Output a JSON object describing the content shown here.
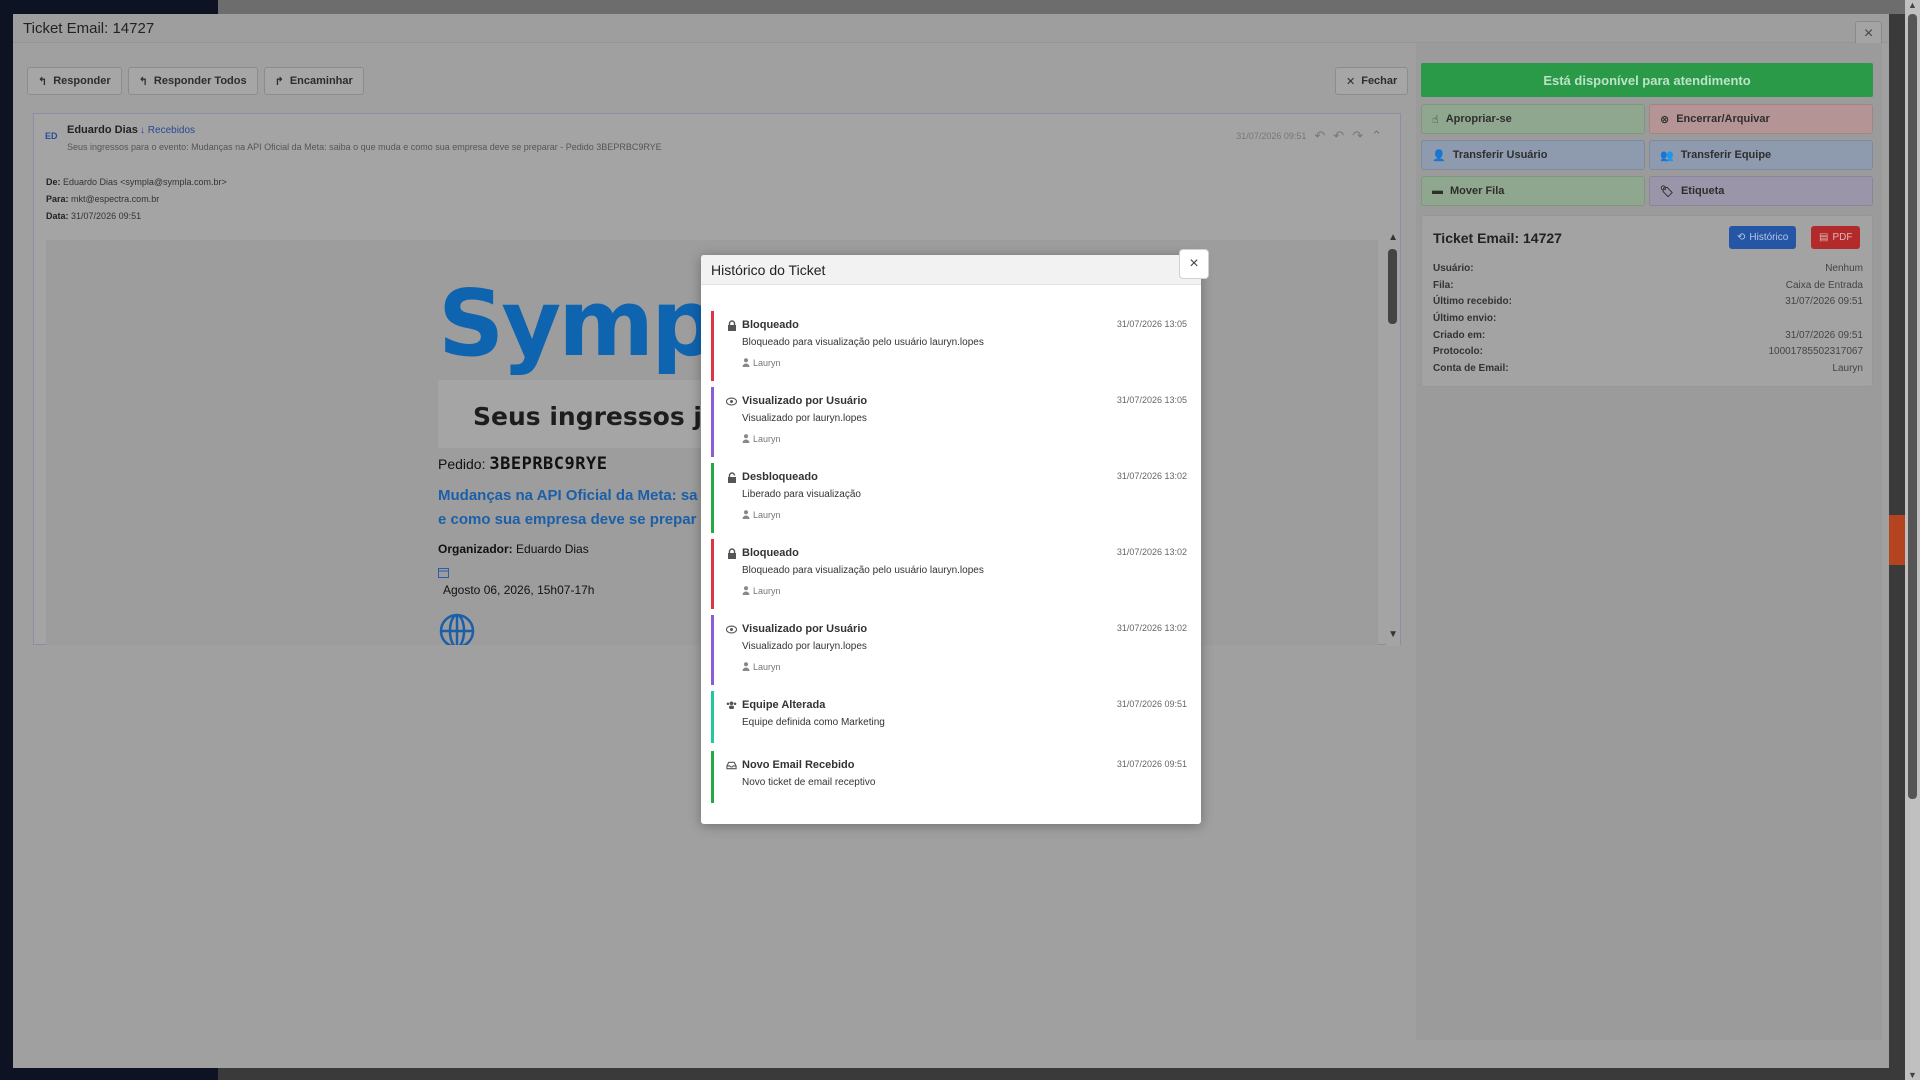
{
  "window": {
    "title": "Ticket Email: 14727",
    "close_label": "×"
  },
  "toolbar": {
    "reply_label": "Responder",
    "reply_all_label": "Responder Todos",
    "forward_label": "Encaminhar",
    "close_label": "Fechar"
  },
  "email": {
    "avatar_initials": "ED",
    "sender_name": "Eduardo Dias",
    "folder_label": "Recebidos",
    "subject": "Seus ingressos para o evento: Mudanças na API Oficial da Meta: saiba o que muda e como sua empresa deve se preparar - Pedido 3BEPRBC9RYE",
    "timestamp": "31/07/2026 09:51",
    "from_label": "De:",
    "from_value": "Eduardo Dias <sympla@sympla.com.br>",
    "to_label": "Para:",
    "to_value": "mkt@espectra.com.br",
    "date_label": "Data:",
    "date_value": "31/07/2026 09:51",
    "body": {
      "logo_text": "Sympl",
      "card_title": "Seus ingressos já",
      "order_label": "Pedido:",
      "order_code": "3BEPRBC9RYE",
      "event_line1": "Mudanças na API Oficial da Meta: sa",
      "event_line2": "e como sua empresa deve se prepar",
      "organizer_label": "Organizador:",
      "organizer_name": "Eduardo Dias",
      "event_date": "Agosto 06, 2026, 15h07-17h"
    }
  },
  "sidebar": {
    "status_label": "Está disponível para atendimento",
    "actions": {
      "claim": "Apropriar-se",
      "close_archive": "Encerrar/Arquivar",
      "transfer_user": "Transferir Usuário",
      "transfer_team": "Transferir Equipe",
      "move_queue": "Mover Fila",
      "tag": "Etiqueta"
    },
    "info": {
      "title": "Ticket Email: 14727",
      "history_button": "Histórico",
      "pdf_button": "PDF",
      "rows": [
        {
          "label": "Usuário:",
          "value": "Nenhum"
        },
        {
          "label": "Fila:",
          "value": "Caixa de Entrada"
        },
        {
          "label": "Último recebido:",
          "value": "31/07/2026 09:51"
        },
        {
          "label": "Último envio:",
          "value": ""
        },
        {
          "label": "Criado em:",
          "value": "31/07/2026 09:51"
        },
        {
          "label": "Protocolo:",
          "value": "10001785502317067"
        },
        {
          "label": "Conta de Email:",
          "value": "Lauryn"
        }
      ]
    }
  },
  "history": {
    "title": "Histórico do Ticket",
    "close_label": "×",
    "items": [
      {
        "icon": "lock-icon",
        "color": "#dc3545",
        "title": "Bloqueado",
        "time": "31/07/2026 13:05",
        "desc": "Bloqueado para visualização pelo usuário lauryn.lopes",
        "user": "Lauryn"
      },
      {
        "icon": "eye-icon",
        "color": "#8a5cd6",
        "title": "Visualizado por Usuário",
        "time": "31/07/2026 13:05",
        "desc": "Visualizado por lauryn.lopes",
        "user": "Lauryn"
      },
      {
        "icon": "unlock-icon",
        "color": "#28a745",
        "title": "Desbloqueado",
        "time": "31/07/2026 13:02",
        "desc": "Liberado para visualização",
        "user": "Lauryn"
      },
      {
        "icon": "lock-icon",
        "color": "#dc3545",
        "title": "Bloqueado",
        "time": "31/07/2026 13:02",
        "desc": "Bloqueado para visualização pelo usuário lauryn.lopes",
        "user": "Lauryn"
      },
      {
        "icon": "eye-icon",
        "color": "#8a5cd6",
        "title": "Visualizado por Usuário",
        "time": "31/07/2026 13:02",
        "desc": "Visualizado por lauryn.lopes",
        "user": "Lauryn"
      },
      {
        "icon": "users-icon",
        "color": "#20c997",
        "title": "Equipe Alterada",
        "time": "31/07/2026 09:51",
        "desc": "Equipe definida como Marketing",
        "user": ""
      },
      {
        "icon": "inbox-icon",
        "color": "#28a745",
        "title": "Novo Email Recebido",
        "time": "31/07/2026 09:51",
        "desc": "Novo ticket de email receptivo",
        "user": ""
      }
    ]
  }
}
